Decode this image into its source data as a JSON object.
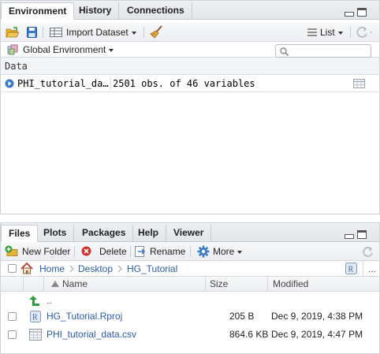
{
  "environment": {
    "tabs": [
      "Environment",
      "History",
      "Connections"
    ],
    "toolbar": {
      "import_label": "Import Dataset",
      "list_label": "List"
    },
    "scope_label": "Global Environment",
    "search": {
      "placeholder": ""
    },
    "section_label": "Data",
    "rows": [
      {
        "name": "PHI_tutorial_da…",
        "value": "2501 obs. of 46 variables"
      }
    ]
  },
  "files": {
    "tabs": [
      "Files",
      "Plots",
      "Packages",
      "Help",
      "Viewer"
    ],
    "toolbar": {
      "new_folder_label": "New Folder",
      "delete_label": "Delete",
      "rename_label": "Rename",
      "more_label": "More"
    },
    "breadcrumb": [
      "Home",
      "Desktop",
      "HG_Tutorial"
    ],
    "ellipsis": "...",
    "columns": {
      "name": "Name",
      "size": "Size",
      "modified": "Modified"
    },
    "parent_label": "..",
    "rows": [
      {
        "name": "HG_Tutorial.Rproj",
        "size": "205 B",
        "modified": "Dec 9, 2019, 4:38 PM",
        "icon": "rproj-icon"
      },
      {
        "name": "PHI_tutorial_data.csv",
        "size": "864.6 KB",
        "modified": "Dec 9, 2019, 4:47 PM",
        "icon": "csv-file-icon"
      }
    ]
  },
  "colors": {
    "link": "#2a5ca8",
    "tab_bar": "#e2e5e9",
    "accent_green": "#2e9d3a",
    "delete_red": "#d0312d",
    "icon_blue": "#3a7bc8"
  }
}
